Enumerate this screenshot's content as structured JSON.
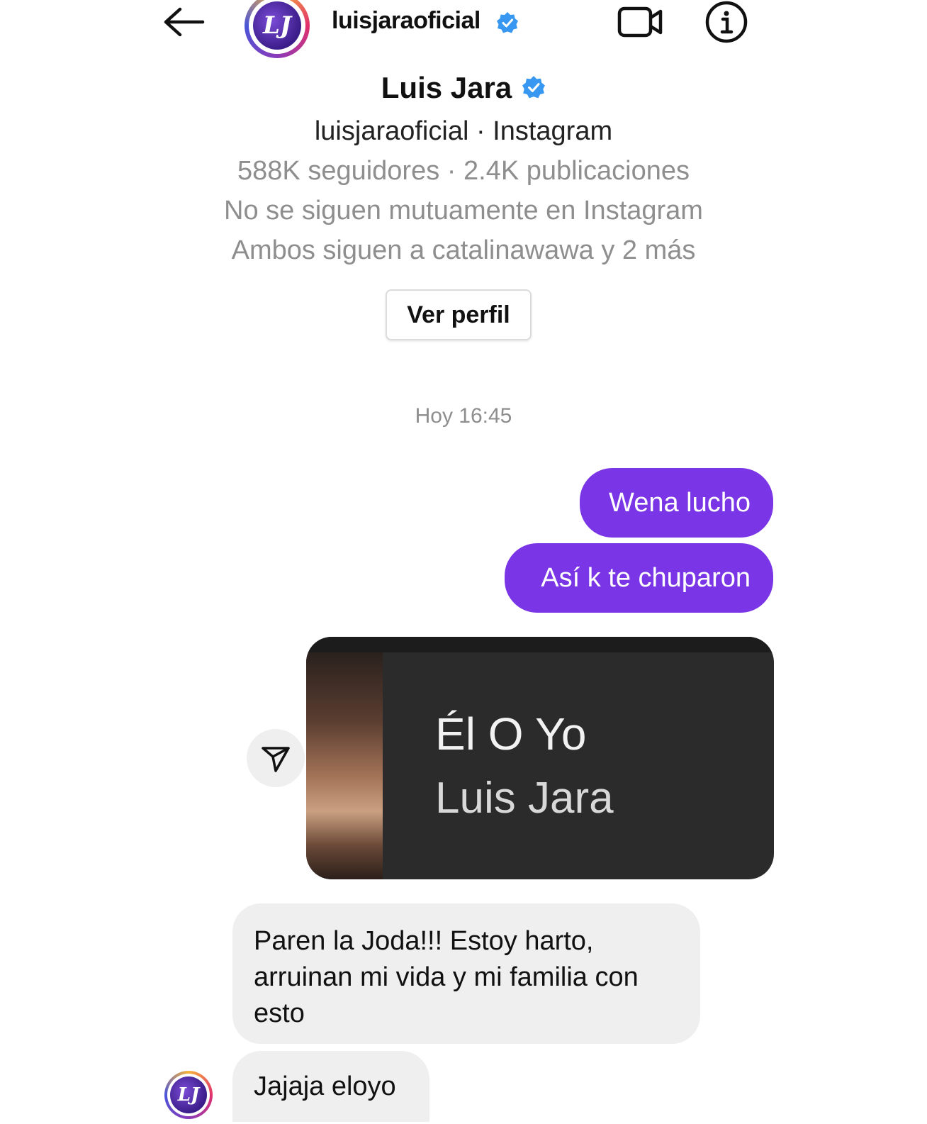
{
  "header": {
    "username": "luisjaraoficial",
    "avatar_letter": "LJ"
  },
  "profile": {
    "name": "Luis Jara",
    "handle_line": "luisjaraoficial · Instagram",
    "stats_line": "588K seguidores · 2.4K publicaciones",
    "mutual_line": "No se siguen mutuamente en Instagram",
    "follow_line": "Ambos siguen a catalinawawa y 2 más",
    "view_profile_label": "Ver perfil"
  },
  "chat": {
    "timestamp": "Hoy 16:45",
    "messages": [
      {
        "from": "me",
        "text": "Wena lucho"
      },
      {
        "from": "me",
        "text": "Así k te chuparon"
      },
      {
        "from": "me",
        "type": "song_share",
        "title": "Él O Yo",
        "artist": "Luis Jara"
      },
      {
        "from": "them",
        "text": "Paren la Joda!!! Estoy harto, arruinan mi vida y mi familia con esto"
      },
      {
        "from": "them",
        "text": "Jajaja eloyo"
      }
    ]
  },
  "colors": {
    "outgoing_bubble": "#7a35e6",
    "incoming_bubble": "#efefef",
    "verified": "#3897f0"
  },
  "icons": {
    "back": "back-arrow-icon",
    "video": "video-call-icon",
    "info": "info-icon",
    "verified": "verified-badge-icon",
    "share": "share-icon"
  }
}
